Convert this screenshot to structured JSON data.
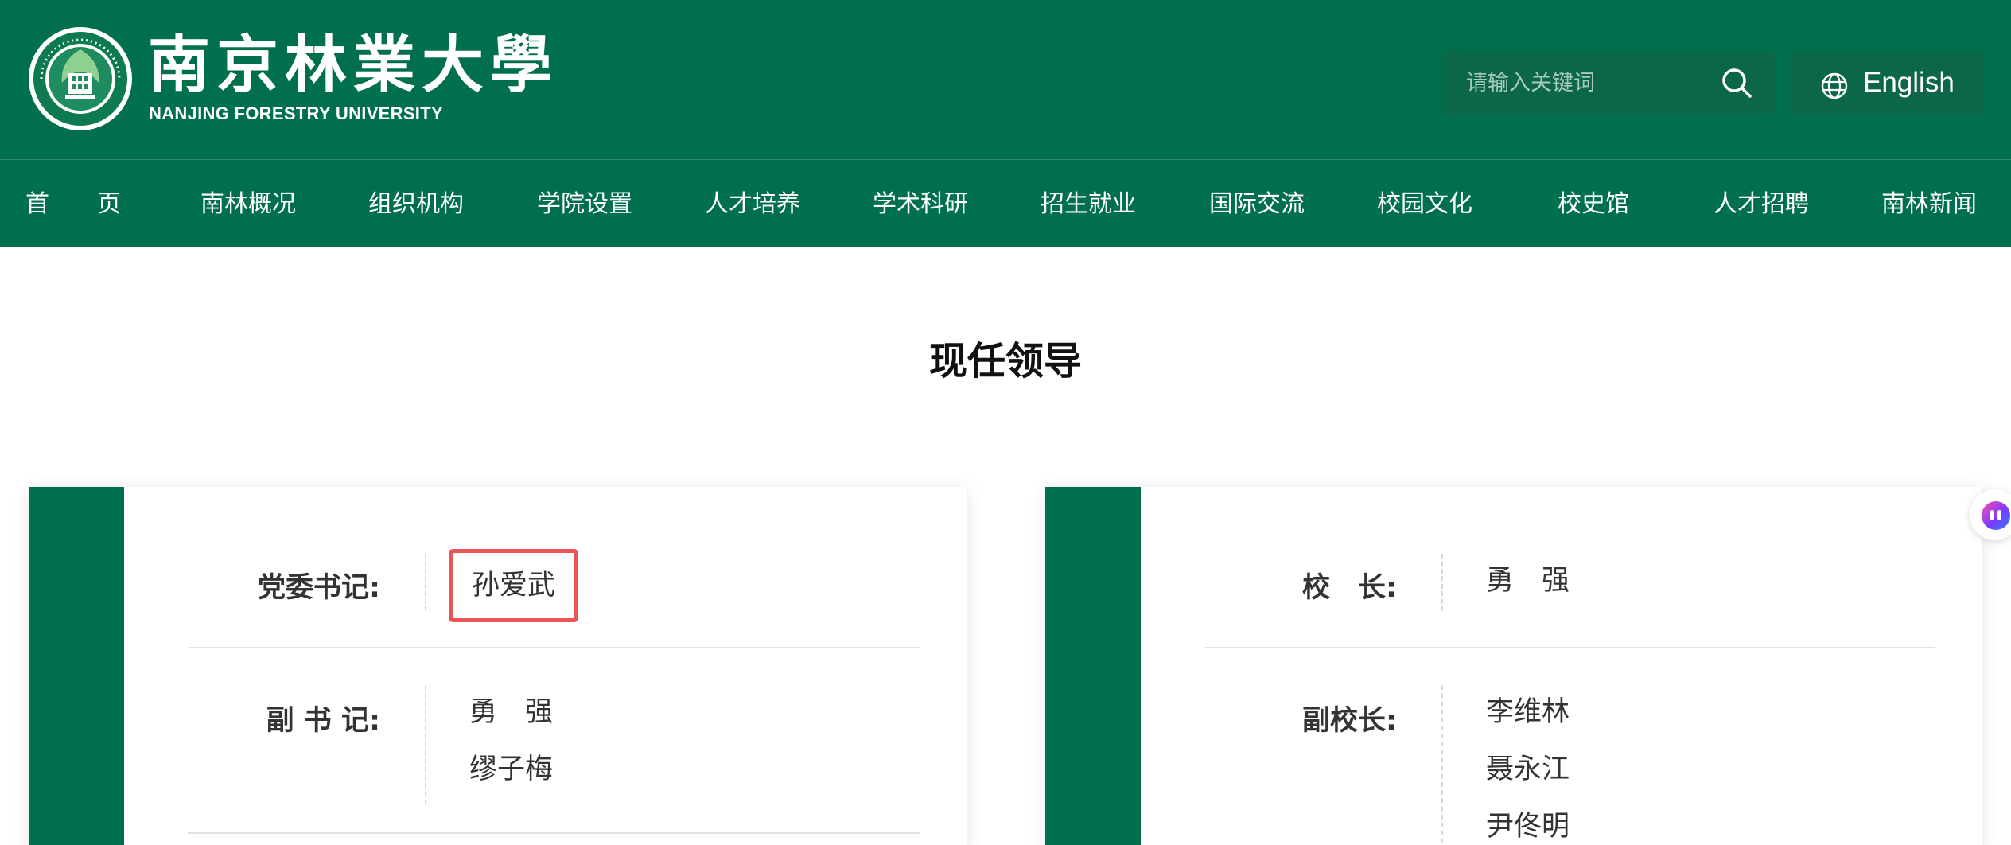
{
  "header": {
    "logo_cn": "南京林業大學",
    "logo_en": "NANJING FORESTRY UNIVERSITY",
    "search": {
      "placeholder": "请输入关键词",
      "icon": "search-icon"
    },
    "lang_button": {
      "label": "English",
      "icon": "globe-icon"
    }
  },
  "nav": {
    "items": [
      {
        "label": "首　　页"
      },
      {
        "label": "南林概况"
      },
      {
        "label": "组织机构"
      },
      {
        "label": "学院设置"
      },
      {
        "label": "人才培养"
      },
      {
        "label": "学术科研"
      },
      {
        "label": "招生就业"
      },
      {
        "label": "国际交流"
      },
      {
        "label": "校园文化"
      },
      {
        "label": "校史馆"
      },
      {
        "label": "人才招聘"
      },
      {
        "label": "南林新闻"
      }
    ]
  },
  "main": {
    "title": "现任领导",
    "party_card": {
      "rows": [
        {
          "label": "党委书记:",
          "values": [
            "孙爱武"
          ]
        },
        {
          "label": "副 书 记:",
          "values": [
            "勇　强",
            "缪子梅"
          ]
        }
      ]
    },
    "admin_card": {
      "rows": [
        {
          "label": "校　长:",
          "values": [
            "勇　强"
          ]
        },
        {
          "label": "副校长:",
          "values": [
            "李维林",
            "聂永江",
            "尹佟明"
          ]
        }
      ]
    }
  },
  "colors": {
    "brand_green": "#006f4e",
    "search_bg": "#0c6648",
    "highlight_red": "#ea5455"
  }
}
